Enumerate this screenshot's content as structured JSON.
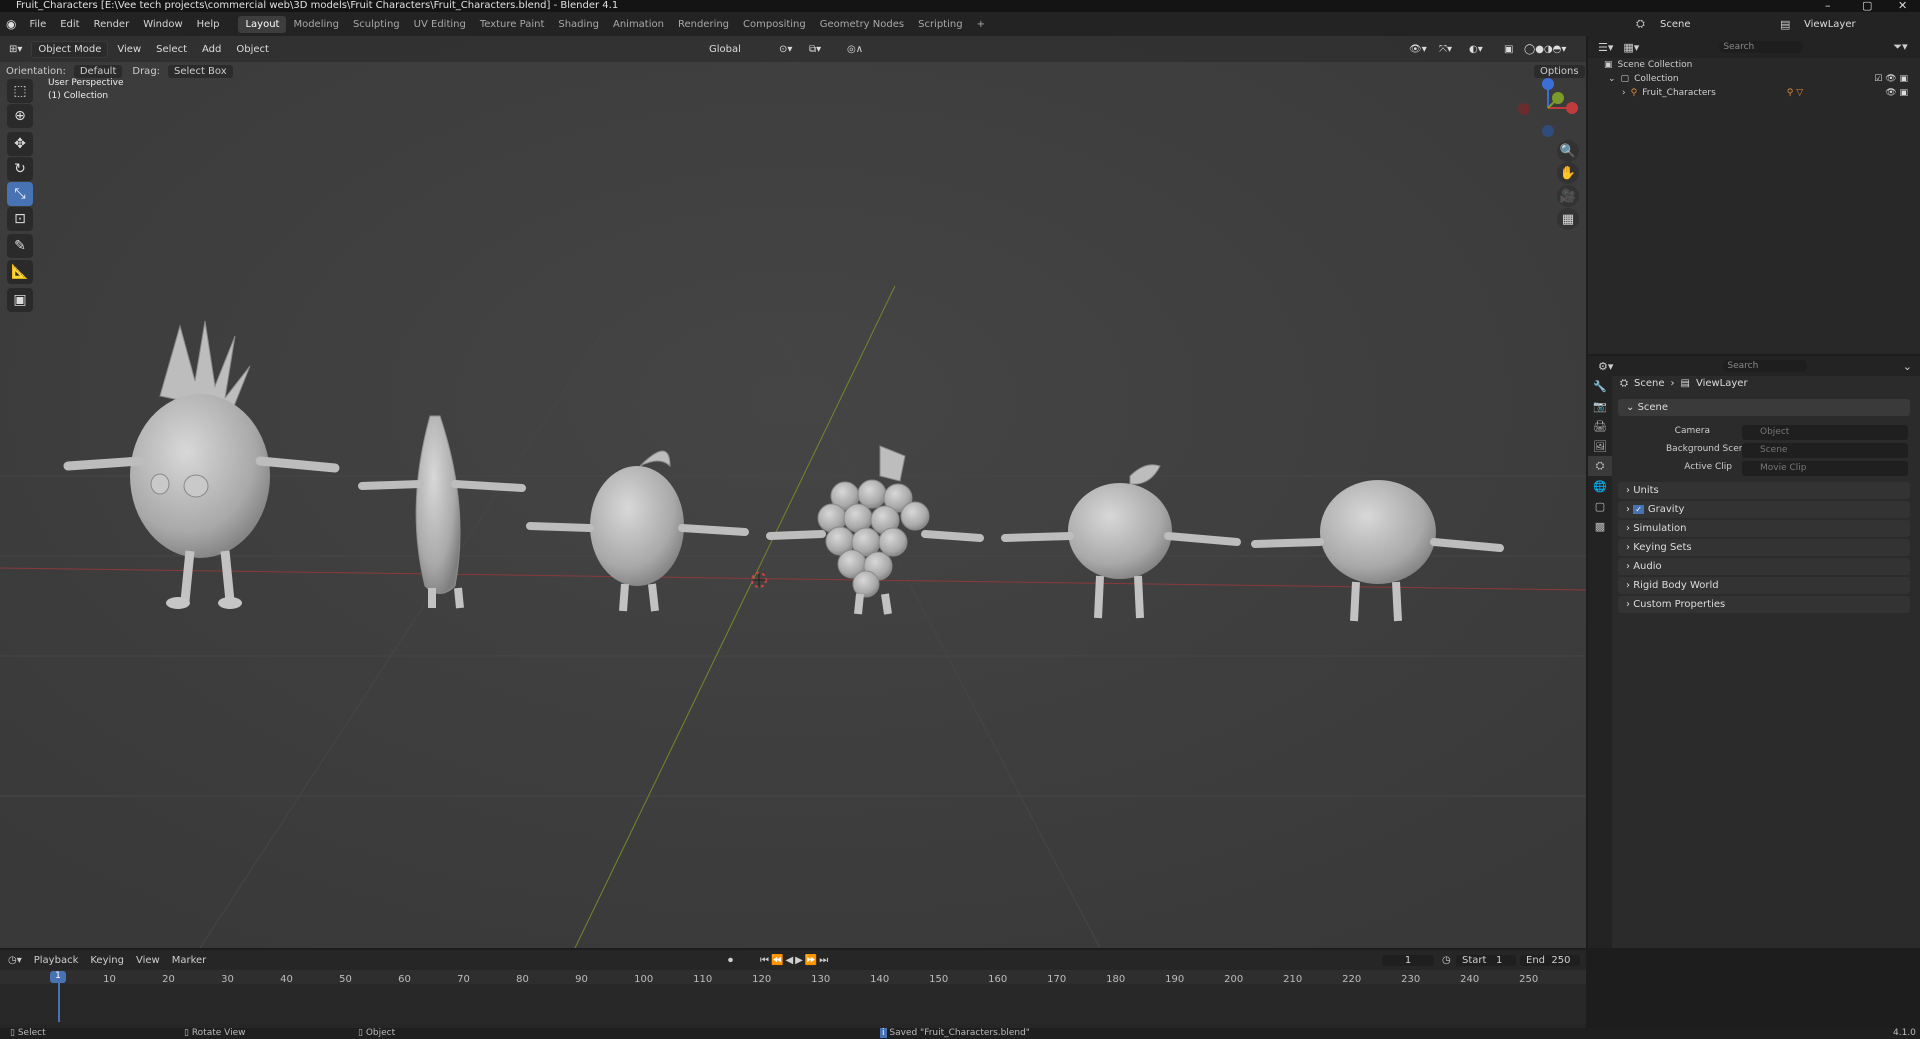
{
  "app": {
    "title": "Fruit_Characters [E:\\Vee tech projects\\commercial web\\3D models\\Fruit Characters\\Fruit_Characters.blend] - Blender 4.1",
    "version": "4.1.0"
  },
  "menu": [
    "File",
    "Edit",
    "Render",
    "Window",
    "Help"
  ],
  "workspaces": [
    "Layout",
    "Modeling",
    "Sculpting",
    "UV Editing",
    "Texture Paint",
    "Shading",
    "Animation",
    "Rendering",
    "Compositing",
    "Geometry Nodes",
    "Scripting"
  ],
  "active_workspace": "Layout",
  "scene_name": "Scene",
  "viewlayer_name": "ViewLayer",
  "viewport": {
    "mode": "Object Mode",
    "menus": [
      "View",
      "Select",
      "Add",
      "Object"
    ],
    "transform_orientation": "Global",
    "orientation_label": "Orientation:",
    "orientation_value": "Default",
    "drag_label": "Drag:",
    "drag_value": "Select Box",
    "options_label": "Options",
    "search_placeholder": "Search",
    "overlay_title": "User Perspective",
    "overlay_collection": "(1) Collection"
  },
  "outliner": {
    "items": [
      {
        "label": "Scene Collection"
      },
      {
        "label": "Collection"
      },
      {
        "label": "Fruit_Characters"
      }
    ]
  },
  "properties": {
    "search_placeholder": "Search",
    "breadcrumb_scene": "Scene",
    "breadcrumb_viewlayer": "ViewLayer",
    "panel_title": "Scene",
    "camera_label": "Camera",
    "camera_placeholder": "Object",
    "bg_label": "Background Scene",
    "bg_placeholder": "Scene",
    "clip_label": "Active Clip",
    "clip_placeholder": "Movie Clip",
    "sections": [
      "Units",
      "Gravity",
      "Simulation",
      "Keying Sets",
      "Audio",
      "Rigid Body World",
      "Custom Properties"
    ]
  },
  "timeline": {
    "menus": [
      "Playback",
      "Keying",
      "View",
      "Marker"
    ],
    "current_frame": "1",
    "start_label": "Start",
    "start_value": "1",
    "end_label": "End",
    "end_value": "250",
    "ticks": [
      "1",
      "10",
      "20",
      "30",
      "40",
      "50",
      "60",
      "70",
      "80",
      "90",
      "100",
      "110",
      "120",
      "130",
      "140",
      "150",
      "160",
      "170",
      "180",
      "190",
      "200",
      "210",
      "220",
      "230",
      "240",
      "250"
    ]
  },
  "status": {
    "select": "Select",
    "rotate": "Rotate View",
    "object": "Object",
    "message": "Saved \"Fruit_Characters.blend\""
  },
  "colors": {
    "accent": "#4772b3",
    "x_axis": "#c23b3b",
    "y_axis": "#7a9a2a",
    "z_axis": "#3a6fd8"
  }
}
